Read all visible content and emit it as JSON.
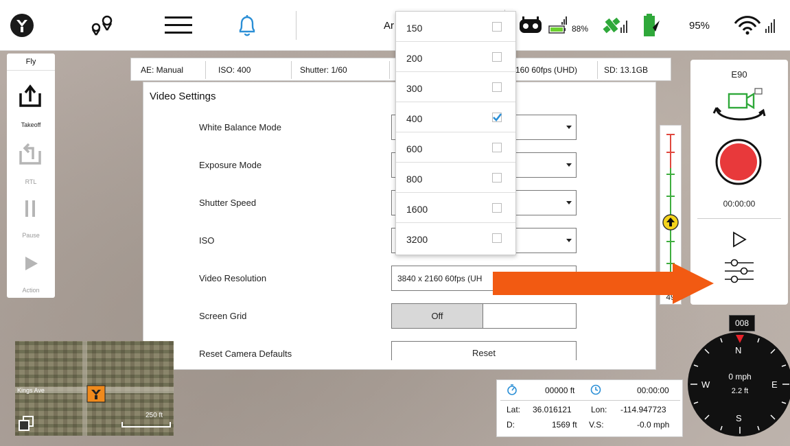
{
  "top_bar": {
    "partial_label": "Ar",
    "controller_battery": "88%",
    "device_battery": "95%"
  },
  "left_toolbar": {
    "title": "Fly",
    "takeoff": "Takeoff",
    "rtl": "RTL",
    "pause": "Pause",
    "action": "Action"
  },
  "status_strip": {
    "ae": "AE:  Manual",
    "iso": "ISO:  400",
    "shutter": "Shutter:  1/60",
    "resolution": "160 60fps (UHD)",
    "sd": "SD:  13.1GB"
  },
  "video_settings": {
    "title": "Video Settings",
    "rows": [
      {
        "label": "White Balance Mode"
      },
      {
        "label": "Exposure Mode"
      },
      {
        "label": "Shutter Speed"
      },
      {
        "label": "ISO"
      },
      {
        "label": "Video Resolution",
        "value": "3840 x 2160 60fps (UH"
      },
      {
        "label": "Screen Grid",
        "value": "Off"
      },
      {
        "label": "Reset Camera Defaults",
        "value": "Reset"
      }
    ]
  },
  "iso_dropdown": {
    "options": [
      {
        "label": "150",
        "checked": false
      },
      {
        "label": "200",
        "checked": false
      },
      {
        "label": "300",
        "checked": false
      },
      {
        "label": "400",
        "checked": true
      },
      {
        "label": "600",
        "checked": false
      },
      {
        "label": "800",
        "checked": false
      },
      {
        "label": "1600",
        "checked": false
      },
      {
        "label": "3200",
        "checked": false
      }
    ]
  },
  "right_panel": {
    "model": "E90",
    "timer": "00:00:00"
  },
  "altitude_slider": {
    "value": "49"
  },
  "compass": {
    "heading": "008",
    "n": "N",
    "s": "S",
    "e": "E",
    "w": "W",
    "speed": "0 mph",
    "height": "2.2 ft"
  },
  "telemetry": {
    "distance": "00000 ft",
    "flight_time": "00:00:00",
    "lat_label": "Lat:",
    "lat": "36.016121",
    "lon_label": "Lon:",
    "lon": "-114.947723",
    "d_label": "D:",
    "d_value": "1569 ft",
    "vs_label": "V.S:",
    "vs_value": "-0.0 mph"
  },
  "map": {
    "street": "Kings Ave",
    "scale": "250 ft"
  },
  "colors": {
    "record_red": "#e8393b",
    "arrow_orange": "#f25a12",
    "check_blue": "#2b8fd6",
    "compass_red": "#e8232a",
    "status_green": "#2fa83a"
  }
}
